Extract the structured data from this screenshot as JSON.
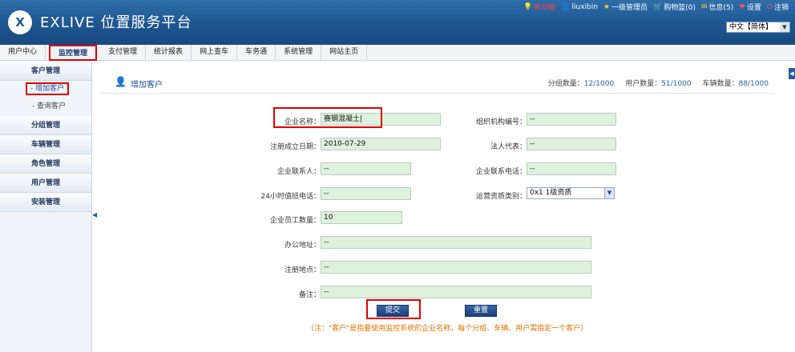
{
  "header": {
    "logo": "X",
    "brand": "EXLIVE 位置服务平台",
    "links": [
      {
        "icon": "bulb-icon",
        "glyph": "💡",
        "label": "新功能"
      },
      {
        "icon": "user-icon",
        "glyph": "👤",
        "label": "liuxibin"
      },
      {
        "icon": "star-icon",
        "glyph": "★",
        "label": "一级管理员"
      },
      {
        "icon": "cart-icon",
        "glyph": "🛒",
        "label": "购物篮(0)"
      },
      {
        "icon": "mail-icon",
        "glyph": "✉",
        "label": "信息(5)"
      },
      {
        "icon": "heart-icon",
        "glyph": "❤",
        "label": "设置"
      },
      {
        "icon": "power-icon",
        "glyph": "⏻",
        "label": "注销"
      }
    ],
    "language": "中文【简体】"
  },
  "nav": [
    "用户中心",
    "监控管理",
    "支付管理",
    "统计报表",
    "网上查车",
    "车务通",
    "系统管理",
    "网站主页"
  ],
  "sidebar": {
    "customer": "客户管理",
    "add_customer": "- 增加客户",
    "query_customer": "- 查询客户",
    "groups": "分组管理",
    "vehicles": "车辆管理",
    "roles": "角色管理",
    "users": "用户管理",
    "install": "安装管理"
  },
  "page": {
    "title": "增加客户",
    "stats": {
      "group_label": "分组数量：",
      "group_value": "12/1000",
      "user_label": "用户数量：",
      "user_value": "51/1000",
      "vehicle_label": "车辆数量：",
      "vehicle_value": "88/1000"
    }
  },
  "form": {
    "company_name_label": "企业名称：",
    "company_name": "赛钢混凝土|",
    "org_code_label": "组织机构编号：",
    "org_code": "--",
    "reg_date_label": "注册成立日期：",
    "reg_date": "2010-07-29",
    "legal_rep_label": "法人代表：",
    "legal_rep": "--",
    "contact_label": "企业联系人：",
    "contact": "--",
    "contact_phone_label": "企业联系电话：",
    "contact_phone": "--",
    "hotline_label": "24小时值班电话：",
    "hotline": "--",
    "qualification_label": "运营资质类别：",
    "qualification": "0x1 1级资质",
    "staff_label": "企业员工数量：",
    "staff": "10",
    "office_label": "办公地址：",
    "office": "--",
    "reg_place_label": "注册地点：",
    "reg_place": "--",
    "remark_label": "备注：",
    "remark": "--",
    "submit": "提交",
    "reset": "重置",
    "note": "（注：\"客户\"是指要使用监控系统的企业名称，每个分组、车辆、用户需指定一个客户）"
  }
}
